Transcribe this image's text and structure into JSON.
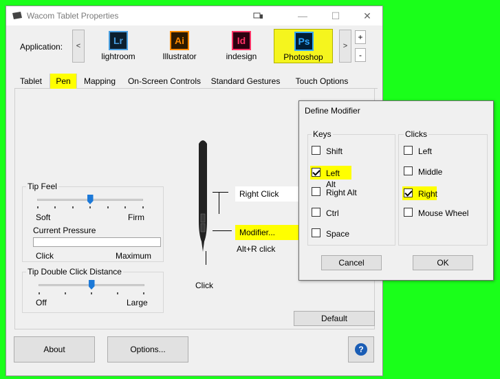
{
  "window": {
    "title": "Wacom Tablet Properties",
    "accent_color": "#ffff00",
    "brand_color": "#1a5db5"
  },
  "application_bar": {
    "label": "Application:",
    "scroll_left": "<",
    "scroll_right": ">",
    "add": "+",
    "remove": "-",
    "apps": [
      {
        "abbr": "Lr",
        "name": "lightroom",
        "color": "#4a9fe0",
        "bg": "#0c1f2e"
      },
      {
        "abbr": "Ai",
        "name": "Illustrator",
        "color": "#ff8a00",
        "bg": "#2c1a00"
      },
      {
        "abbr": "Id",
        "name": "indesign",
        "color": "#ff3366",
        "bg": "#2c0010"
      },
      {
        "abbr": "Ps",
        "name": "Photoshop",
        "color": "#31a8ff",
        "bg": "#001e36",
        "selected": true
      }
    ]
  },
  "tabs": [
    "Tablet",
    "Pen",
    "Mapping",
    "On-Screen Controls",
    "Standard Gestures",
    "Touch Options"
  ],
  "selected_tab": "Pen",
  "tip_feel": {
    "title": "Tip Feel",
    "min_label": "Soft",
    "max_label": "Firm",
    "level_fraction": 0.5,
    "current_pressure_label": "Current Pressure",
    "pressure_min": "Click",
    "pressure_max": "Maximum"
  },
  "tip_double_click": {
    "title": "Tip Double Click Distance",
    "min_label": "Off",
    "max_label": "Large",
    "level_fraction": 0.5
  },
  "pen": {
    "upper_button": "Right Click",
    "lower_button": "Modifier...",
    "lower_button_detail": "Alt+R click",
    "tip": "Click"
  },
  "buttons": {
    "default": "Default",
    "about": "About",
    "options": "Options...",
    "help": "?"
  },
  "define_modifier": {
    "title": "Define Modifier",
    "keys_title": "Keys",
    "keys": [
      {
        "label": "Shift",
        "checked": false
      },
      {
        "label": "Left Alt",
        "checked": true
      },
      {
        "label": "Right Alt",
        "checked": false
      },
      {
        "label": "Ctrl",
        "checked": false
      },
      {
        "label": "Space",
        "checked": false
      }
    ],
    "clicks_title": "Clicks",
    "clicks": [
      {
        "label": "Left",
        "checked": false
      },
      {
        "label": "Middle",
        "checked": false
      },
      {
        "label": "Right",
        "checked": true
      },
      {
        "label": "Mouse Wheel",
        "checked": false
      }
    ],
    "cancel": "Cancel",
    "ok": "OK"
  }
}
